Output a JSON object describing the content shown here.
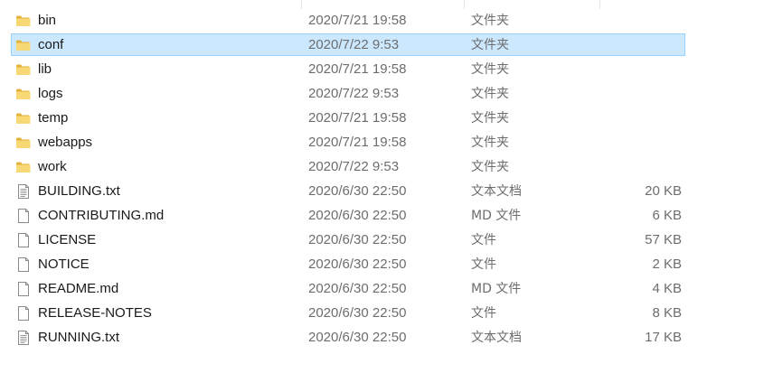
{
  "files": [
    {
      "name": "bin",
      "date": "2020/7/21 19:58",
      "type": "文件夹",
      "size": "",
      "icon": "folder-icon",
      "selected": false
    },
    {
      "name": "conf",
      "date": "2020/7/22 9:53",
      "type": "文件夹",
      "size": "",
      "icon": "folder-icon",
      "selected": true
    },
    {
      "name": "lib",
      "date": "2020/7/21 19:58",
      "type": "文件夹",
      "size": "",
      "icon": "folder-icon",
      "selected": false
    },
    {
      "name": "logs",
      "date": "2020/7/22 9:53",
      "type": "文件夹",
      "size": "",
      "icon": "folder-icon",
      "selected": false
    },
    {
      "name": "temp",
      "date": "2020/7/21 19:58",
      "type": "文件夹",
      "size": "",
      "icon": "folder-icon",
      "selected": false
    },
    {
      "name": "webapps",
      "date": "2020/7/21 19:58",
      "type": "文件夹",
      "size": "",
      "icon": "folder-icon",
      "selected": false
    },
    {
      "name": "work",
      "date": "2020/7/22 9:53",
      "type": "文件夹",
      "size": "",
      "icon": "folder-icon",
      "selected": false
    },
    {
      "name": "BUILDING.txt",
      "date": "2020/6/30 22:50",
      "type": "文本文档",
      "size": "20 KB",
      "icon": "text-file-icon",
      "selected": false
    },
    {
      "name": "CONTRIBUTING.md",
      "date": "2020/6/30 22:50",
      "type": "MD 文件",
      "size": "6 KB",
      "icon": "file-icon",
      "selected": false
    },
    {
      "name": "LICENSE",
      "date": "2020/6/30 22:50",
      "type": "文件",
      "size": "57 KB",
      "icon": "file-icon",
      "selected": false
    },
    {
      "name": "NOTICE",
      "date": "2020/6/30 22:50",
      "type": "文件",
      "size": "2 KB",
      "icon": "file-icon",
      "selected": false
    },
    {
      "name": "README.md",
      "date": "2020/6/30 22:50",
      "type": "MD 文件",
      "size": "4 KB",
      "icon": "file-icon",
      "selected": false
    },
    {
      "name": "RELEASE-NOTES",
      "date": "2020/6/30 22:50",
      "type": "文件",
      "size": "8 KB",
      "icon": "file-icon",
      "selected": false
    },
    {
      "name": "RUNNING.txt",
      "date": "2020/6/30 22:50",
      "type": "文本文档",
      "size": "17 KB",
      "icon": "text-file-icon",
      "selected": false
    }
  ],
  "colors": {
    "selection_bg": "#cce8ff",
    "selection_border": "#99d1ff",
    "folder": "#f8d775",
    "folder_dark": "#e3b23c"
  }
}
